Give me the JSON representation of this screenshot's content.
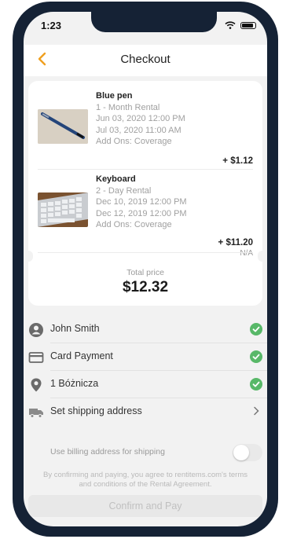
{
  "status": {
    "time": "1:23"
  },
  "nav": {
    "title": "Checkout"
  },
  "colors": {
    "accent": "#f0a020",
    "check": "#58b868",
    "frame": "#152235"
  },
  "items": [
    {
      "name": "Blue pen",
      "rental": "1 - Month Rental",
      "start": "Jun 03, 2020 12:00 PM",
      "end": "Jul 03, 2020 11:00 AM",
      "addons": "Add Ons: Coverage",
      "price": "+ $1.12"
    },
    {
      "name": "Keyboard",
      "rental": "2 - Day Rental",
      "start": "Dec 10, 2019 12:00 PM",
      "end": "Dec 12, 2019 12:00 PM",
      "addons": "Add Ons: Coverage",
      "price": "+ $11.20",
      "price_sub": "N/A"
    }
  ],
  "total": {
    "label": "Total price",
    "value": "$12.32"
  },
  "rows": [
    {
      "label": "John Smith",
      "icon": "user-icon",
      "checked": true
    },
    {
      "label": "Card Payment",
      "icon": "card-icon",
      "checked": true
    },
    {
      "label": "1 Bóżnicza",
      "icon": "location-pin-icon",
      "checked": true
    },
    {
      "label": "Set shipping address",
      "icon": "truck-icon",
      "checked": false
    }
  ],
  "shipping_toggle": {
    "label": "Use billing address for shipping"
  },
  "terms": "By confirming and paying, you agree to rentitems.com's terms and conditions of the Rental Agreement.",
  "cta": {
    "label": "Confirm and Pay"
  }
}
